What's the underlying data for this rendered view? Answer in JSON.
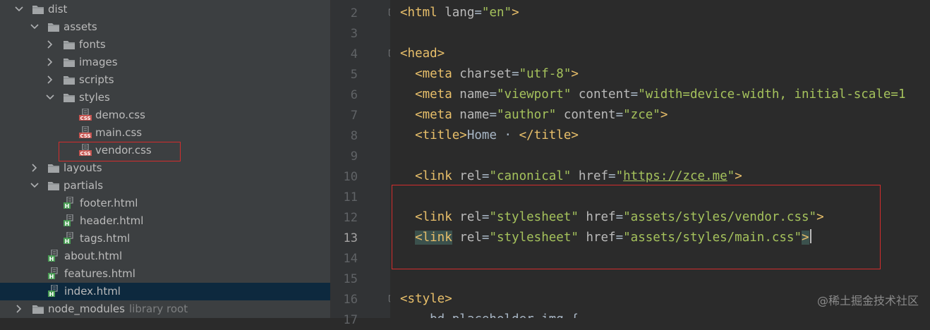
{
  "project_tree": {
    "rows": [
      {
        "label": "dist",
        "kind": "folder",
        "expanded": true
      },
      {
        "label": "assets",
        "kind": "folder",
        "expanded": true
      },
      {
        "label": "fonts",
        "kind": "folder",
        "expanded": false
      },
      {
        "label": "images",
        "kind": "folder",
        "expanded": false
      },
      {
        "label": "scripts",
        "kind": "folder",
        "expanded": false
      },
      {
        "label": "styles",
        "kind": "folder",
        "expanded": true
      },
      {
        "label": "demo.css",
        "kind": "css-file"
      },
      {
        "label": "main.css",
        "kind": "css-file"
      },
      {
        "label": "vendor.css",
        "kind": "css-file",
        "annotated": true
      },
      {
        "label": "layouts",
        "kind": "folder",
        "expanded": false
      },
      {
        "label": "partials",
        "kind": "folder",
        "expanded": true
      },
      {
        "label": "footer.html",
        "kind": "html-file"
      },
      {
        "label": "header.html",
        "kind": "html-file"
      },
      {
        "label": "tags.html",
        "kind": "html-file"
      },
      {
        "label": "about.html",
        "kind": "html-file"
      },
      {
        "label": "features.html",
        "kind": "html-file"
      },
      {
        "label": "index.html",
        "kind": "html-file",
        "selected": true
      },
      {
        "label": "node_modules",
        "kind": "folder",
        "expanded": false,
        "suffix": "library root"
      }
    ]
  },
  "editor": {
    "current_line": "13",
    "lines": [
      {
        "number": "2",
        "fold": "open",
        "tokens": [
          [
            "t",
            "<html "
          ],
          [
            "a",
            "lang"
          ],
          [
            "p",
            "="
          ],
          [
            "s",
            "\"en\""
          ],
          [
            "t",
            ">"
          ]
        ]
      },
      {
        "number": "3",
        "tokens": []
      },
      {
        "number": "4",
        "fold": "open",
        "tokens": [
          [
            "t",
            "<head>"
          ]
        ]
      },
      {
        "number": "5",
        "tokens": [
          [
            "p",
            "  "
          ],
          [
            "t",
            "<meta "
          ],
          [
            "a",
            "charset"
          ],
          [
            "p",
            "="
          ],
          [
            "s",
            "\"utf-8\""
          ],
          [
            "t",
            ">"
          ]
        ]
      },
      {
        "number": "6",
        "tokens": [
          [
            "p",
            "  "
          ],
          [
            "t",
            "<meta "
          ],
          [
            "a",
            "name"
          ],
          [
            "p",
            "="
          ],
          [
            "s",
            "\"viewport\""
          ],
          [
            "a",
            " content"
          ],
          [
            "p",
            "="
          ],
          [
            "s",
            "\"width=device-width, initial-scale=1"
          ]
        ]
      },
      {
        "number": "7",
        "tokens": [
          [
            "p",
            "  "
          ],
          [
            "t",
            "<meta "
          ],
          [
            "a",
            "name"
          ],
          [
            "p",
            "="
          ],
          [
            "s",
            "\"author\""
          ],
          [
            "a",
            " content"
          ],
          [
            "p",
            "="
          ],
          [
            "s",
            "\"zce\""
          ],
          [
            "t",
            ">"
          ]
        ]
      },
      {
        "number": "8",
        "tokens": [
          [
            "p",
            "  "
          ],
          [
            "t",
            "<title>"
          ],
          [
            "p",
            "Home · "
          ],
          [
            "t",
            "</title>"
          ]
        ]
      },
      {
        "number": "9",
        "tokens": []
      },
      {
        "number": "10",
        "tokens": [
          [
            "p",
            "  "
          ],
          [
            "t",
            "<link "
          ],
          [
            "a",
            "rel"
          ],
          [
            "p",
            "="
          ],
          [
            "s",
            "\"canonical\""
          ],
          [
            "a",
            " href"
          ],
          [
            "p",
            "="
          ],
          [
            "s",
            "\""
          ],
          [
            "u",
            "https://zce.me"
          ],
          [
            "s",
            "\""
          ],
          [
            "t",
            ">"
          ]
        ]
      },
      {
        "number": "11",
        "tokens": []
      },
      {
        "number": "12",
        "tokens": [
          [
            "p",
            "  "
          ],
          [
            "t",
            "<link "
          ],
          [
            "a",
            "rel"
          ],
          [
            "p",
            "="
          ],
          [
            "s",
            "\"stylesheet\""
          ],
          [
            "a",
            " href"
          ],
          [
            "p",
            "="
          ],
          [
            "s",
            "\"assets/styles/vendor.css\""
          ],
          [
            "t",
            ">"
          ]
        ]
      },
      {
        "number": "13",
        "current": true,
        "tokens": [
          [
            "p",
            "  "
          ],
          [
            "th",
            "<link"
          ],
          [
            "t",
            " "
          ],
          [
            "a",
            "rel"
          ],
          [
            "p",
            "="
          ],
          [
            "s",
            "\"stylesheet\""
          ],
          [
            "a",
            " href"
          ],
          [
            "p",
            "="
          ],
          [
            "s",
            "\"assets/styles/main.css\""
          ],
          [
            "th",
            ">"
          ],
          [
            "c",
            ""
          ]
        ]
      },
      {
        "number": "14",
        "tokens": []
      },
      {
        "number": "15",
        "tokens": []
      },
      {
        "number": "16",
        "fold": "open",
        "tokens": [
          [
            "t",
            "<style>"
          ]
        ]
      },
      {
        "number": "17",
        "tokens": [
          [
            "p",
            "   .bd-placeholder-img {"
          ]
        ]
      }
    ]
  },
  "colors": {
    "tree_bg": "#3c3f41",
    "editor_bg": "#2b2b2b",
    "tag": "#e8bf6a",
    "attribute": "#bababa",
    "string": "#a5c25c",
    "annotation_box": "#d32d2d"
  },
  "watermark": "@稀土掘金技术社区"
}
